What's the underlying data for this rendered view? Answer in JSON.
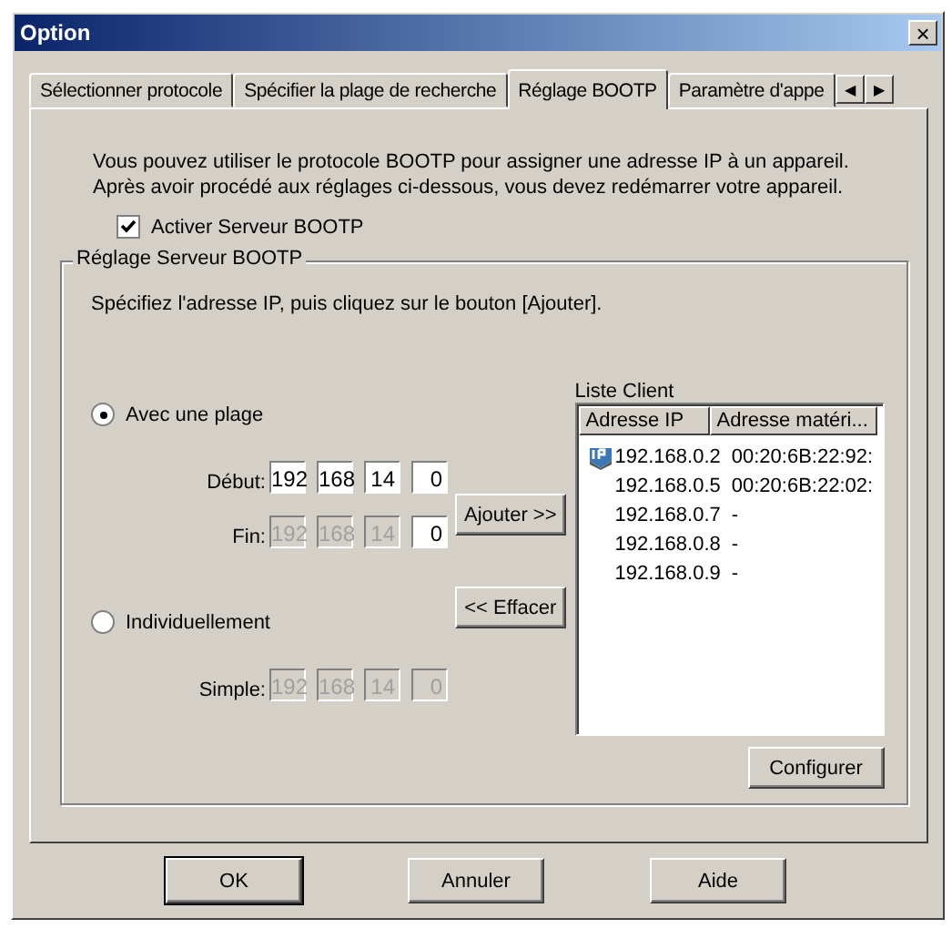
{
  "window": {
    "title": "Option",
    "close": "×"
  },
  "tabs": [
    {
      "label": "Sélectionner protocole",
      "selected": false
    },
    {
      "label": "Spécifier la plage de recherche",
      "selected": false
    },
    {
      "label": "Réglage BOOTP",
      "selected": true
    },
    {
      "label": "Paramètre d'appe",
      "selected": false
    }
  ],
  "tab_scroll": [
    "◀",
    "▶"
  ],
  "intro": "Vous pouvez utiliser le protocole BOOTP pour assigner une adresse IP à un appareil. Après avoir procédé aux réglages ci-dessous, vous devez redémarrer votre appareil.",
  "enable_server": {
    "label": "Activer Serveur BOOTP",
    "checked": true
  },
  "group": {
    "title": "Réglage Serveur BOOTP",
    "instruction": "Spécifiez l'adresse IP, puis cliquez sur le bouton [Ajouter].",
    "modes": [
      {
        "label": "Avec une plage",
        "selected": true,
        "fields": [
          {
            "label": "Début:",
            "octets": [
              {
                "value": "192",
                "disabled": false
              },
              {
                "value": "168",
                "disabled": false
              },
              {
                "value": "14",
                "disabled": false
              },
              {
                "value": "0",
                "disabled": false
              }
            ]
          },
          {
            "label": "Fin:",
            "octets": [
              {
                "value": "192",
                "disabled": true
              },
              {
                "value": "168",
                "disabled": true
              },
              {
                "value": "14",
                "disabled": true
              },
              {
                "value": "0",
                "disabled": false
              }
            ]
          }
        ]
      },
      {
        "label": "Individuellement",
        "selected": false,
        "fields": [
          {
            "label": "Simple:",
            "octets": [
              {
                "value": "192",
                "disabled": true
              },
              {
                "value": "168",
                "disabled": true
              },
              {
                "value": "14",
                "disabled": true
              },
              {
                "value": "0",
                "disabled": true
              }
            ]
          }
        ]
      }
    ],
    "add_button": "Ajouter >>",
    "remove_button": "<< Effacer",
    "client_list": {
      "label": "Liste Client",
      "columns": [
        "Adresse IP",
        "Adresse matéri..."
      ],
      "rows": [
        {
          "ip": "192.168.0.2",
          "mac": "00:20:6B:22:92:",
          "icon": true
        },
        {
          "ip": "192.168.0.5",
          "mac": "00:20:6B:22:02:",
          "icon": false
        },
        {
          "ip": "192.168.0.7",
          "mac": "-",
          "icon": false
        },
        {
          "ip": "192.168.0.8",
          "mac": "-",
          "icon": false
        },
        {
          "ip": "192.168.0.9",
          "mac": "-",
          "icon": false
        }
      ]
    },
    "configure_button": "Configurer"
  },
  "buttons": [
    {
      "label": "OK",
      "default": true
    },
    {
      "label": "Annuler",
      "default": false
    },
    {
      "label": "Aide",
      "default": false
    }
  ]
}
